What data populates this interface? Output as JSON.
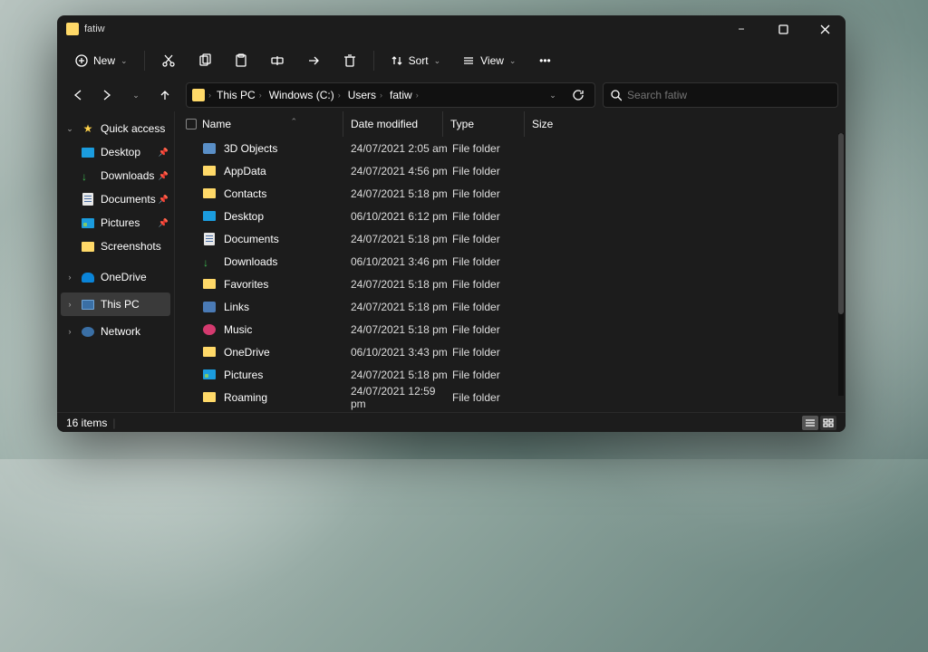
{
  "window": {
    "title": "fatiw",
    "min": "−",
    "max": "▢",
    "close": "✕"
  },
  "toolbar": {
    "new": "New",
    "sort": "Sort",
    "view": "View"
  },
  "nav": {
    "back": "←",
    "fwd": "→",
    "up": "↑"
  },
  "breadcrumb": [
    "This PC",
    "Windows (C:)",
    "Users",
    "fatiw"
  ],
  "search": {
    "placeholder": "Search fatiw"
  },
  "sidebar": {
    "quick_access": "Quick access",
    "items": [
      {
        "label": "Desktop",
        "icon": "deskico",
        "pin": true
      },
      {
        "label": "Downloads",
        "icon": "dlico",
        "pin": true
      },
      {
        "label": "Documents",
        "icon": "docico",
        "pin": true
      },
      {
        "label": "Pictures",
        "icon": "picico",
        "pin": true
      },
      {
        "label": "Screenshots",
        "icon": "fold-y",
        "pin": false
      }
    ],
    "onedrive": "OneDrive",
    "thispc": "This PC",
    "network": "Network"
  },
  "columns": {
    "name": "Name",
    "date": "Date modified",
    "type": "Type",
    "size": "Size"
  },
  "rows": [
    {
      "name": "3D Objects",
      "icon": "threedico",
      "date": "24/07/2021 2:05 am",
      "type": "File folder"
    },
    {
      "name": "AppData",
      "icon": "fold-y",
      "date": "24/07/2021 4:56 pm",
      "type": "File folder"
    },
    {
      "name": "Contacts",
      "icon": "fold-y",
      "date": "24/07/2021 5:18 pm",
      "type": "File folder"
    },
    {
      "name": "Desktop",
      "icon": "deskico",
      "date": "06/10/2021 6:12 pm",
      "type": "File folder"
    },
    {
      "name": "Documents",
      "icon": "docico",
      "date": "24/07/2021 5:18 pm",
      "type": "File folder"
    },
    {
      "name": "Downloads",
      "icon": "dlico",
      "date": "06/10/2021 3:46 pm",
      "type": "File folder"
    },
    {
      "name": "Favorites",
      "icon": "fold-y",
      "date": "24/07/2021 5:18 pm",
      "type": "File folder"
    },
    {
      "name": "Links",
      "icon": "linkico",
      "date": "24/07/2021 5:18 pm",
      "type": "File folder"
    },
    {
      "name": "Music",
      "icon": "musicico",
      "date": "24/07/2021 5:18 pm",
      "type": "File folder"
    },
    {
      "name": "OneDrive",
      "icon": "fold-y",
      "date": "06/10/2021 3:43 pm",
      "type": "File folder"
    },
    {
      "name": "Pictures",
      "icon": "picico",
      "date": "24/07/2021 5:18 pm",
      "type": "File folder"
    },
    {
      "name": "Roaming",
      "icon": "fold-y",
      "date": "24/07/2021 12:59 pm",
      "type": "File folder"
    }
  ],
  "status": {
    "count": "16 items"
  }
}
